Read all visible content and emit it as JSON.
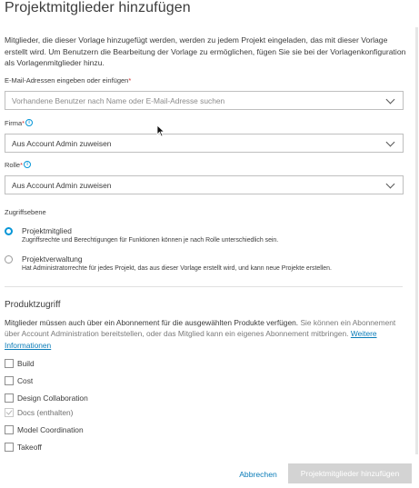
{
  "dialog": {
    "title": "Projektmitglieder hinzufügen",
    "intro": "Mitglieder, die dieser Vorlage hinzugefügt werden, werden zu jedem Projekt eingeladen, das mit dieser Vorlage erstellt wird. Um Benutzern die Bearbeitung der Vorlage zu ermöglichen, fügen Sie sie bei der Vorlagenkonfiguration als Vorlagenmitglieder hinzu."
  },
  "email": {
    "label": "E-Mail-Adressen eingeben oder einfügen",
    "required_mark": "*",
    "placeholder": "Vorhandene Benutzer nach Name oder E-Mail-Adresse suchen",
    "value": ""
  },
  "company": {
    "label": "Firma",
    "required_mark": "*",
    "value": "Aus Account Admin zuweisen"
  },
  "role": {
    "label": "Rolle",
    "required_mark": "*",
    "value": "Aus Account Admin zuweisen"
  },
  "access_level": {
    "label": "Zugriffsebene",
    "options": [
      {
        "title": "Projektmitglied",
        "description": "Zugriffsrechte und Berechtigungen für Funktionen können je nach Rolle unterschiedlich sein.",
        "selected": true
      },
      {
        "title": "Projektverwaltung",
        "description": "Hat Administratorrechte für jedes Projekt, das aus dieser Vorlage erstellt wird, und kann neue Projekte erstellen.",
        "selected": false
      }
    ]
  },
  "product_access": {
    "title": "Produktzugriff",
    "desc_main": "Mitglieder müssen auch über ein Abonnement für die ausgewählten Produkte verfügen.",
    "desc_muted": "Sie können ein Abonnement über Account Administration bereitstellen, oder das Mitglied kann ein eigenes Abonnement mitbringen.",
    "link": "Weitere Informationen",
    "products": [
      {
        "label": "Build",
        "checked": false,
        "disabled": false
      },
      {
        "label": "Cost",
        "checked": false,
        "disabled": false
      },
      {
        "label": "Design Collaboration",
        "checked": false,
        "disabled": false
      },
      {
        "label": "Docs  (enthalten)",
        "checked": true,
        "disabled": true
      },
      {
        "label": "Model Coordination",
        "checked": false,
        "disabled": false
      },
      {
        "label": "Takeoff",
        "checked": false,
        "disabled": false
      }
    ]
  },
  "footer": {
    "cancel_label": "Abbrechen",
    "submit_label": "Projektmitglieder hinzufügen"
  },
  "colors": {
    "accent": "#0696d7",
    "link": "#0a7cb8",
    "required": "#d32f2f",
    "disabled_button": "#d3d3d3"
  }
}
